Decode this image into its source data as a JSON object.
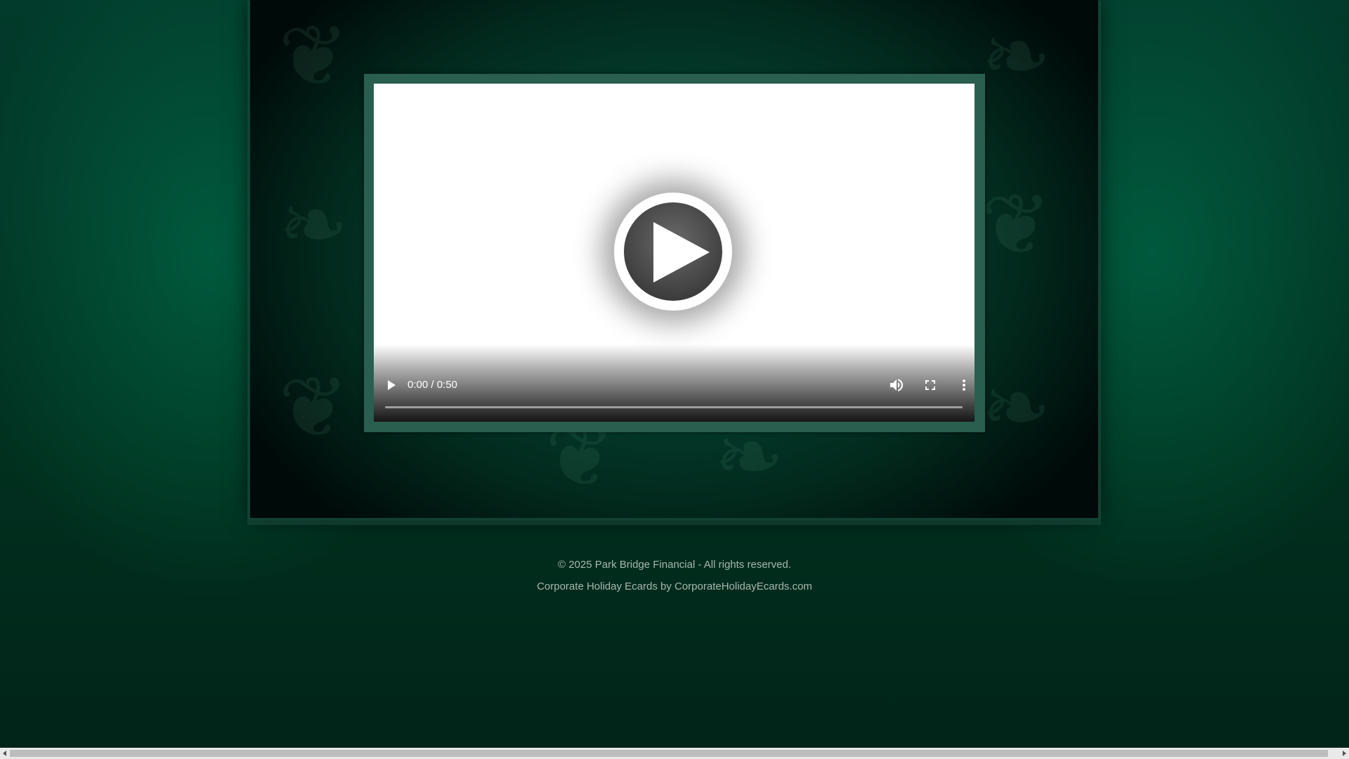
{
  "video": {
    "time_display": "0:00 / 0:50",
    "progress": 0
  },
  "footer": {
    "copyright": "© 2025 Park Bridge Financial - All rights reserved.",
    "credit": "Corporate Holiday Ecards by CorporateHolidayEcards.com"
  },
  "icons": {
    "play": "play-icon",
    "volume": "volume-icon",
    "fullscreen": "fullscreen-icon",
    "more": "more-options-icon"
  },
  "colors": {
    "background": "#023a2b",
    "frame": "#2a5e4f",
    "footer_text": "#a7b8b1"
  }
}
